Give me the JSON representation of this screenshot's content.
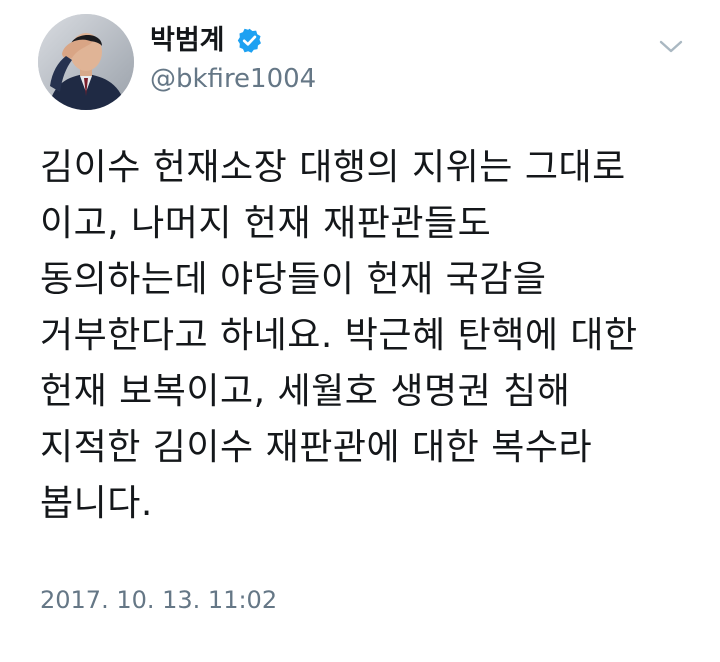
{
  "tweet": {
    "author": {
      "display_name": "박범계",
      "handle": "@bkfire1004",
      "verified": true
    },
    "text_lines": [
      "김이수 헌재소장 대행의 지위는 그대로",
      "이고, 나머지 헌재 재판관들도",
      "동의하는데 야당들이 헌재 국감을",
      "거부한다고 하네요. 박근혜 탄핵에 대한",
      "헌재 보복이고, 세월호 생명권 침해",
      "지적한 김이수 재판관에 대한 복수라",
      "봅니다."
    ],
    "timestamp": "2017. 10. 13. 11:02"
  },
  "colors": {
    "text": "#14171a",
    "secondary": "#657786",
    "verified_blue": "#1da1f2",
    "background": "#ffffff"
  },
  "icons": {
    "verified": "verified-badge-icon",
    "menu": "chevron-down-icon",
    "avatar": "profile-photo"
  }
}
